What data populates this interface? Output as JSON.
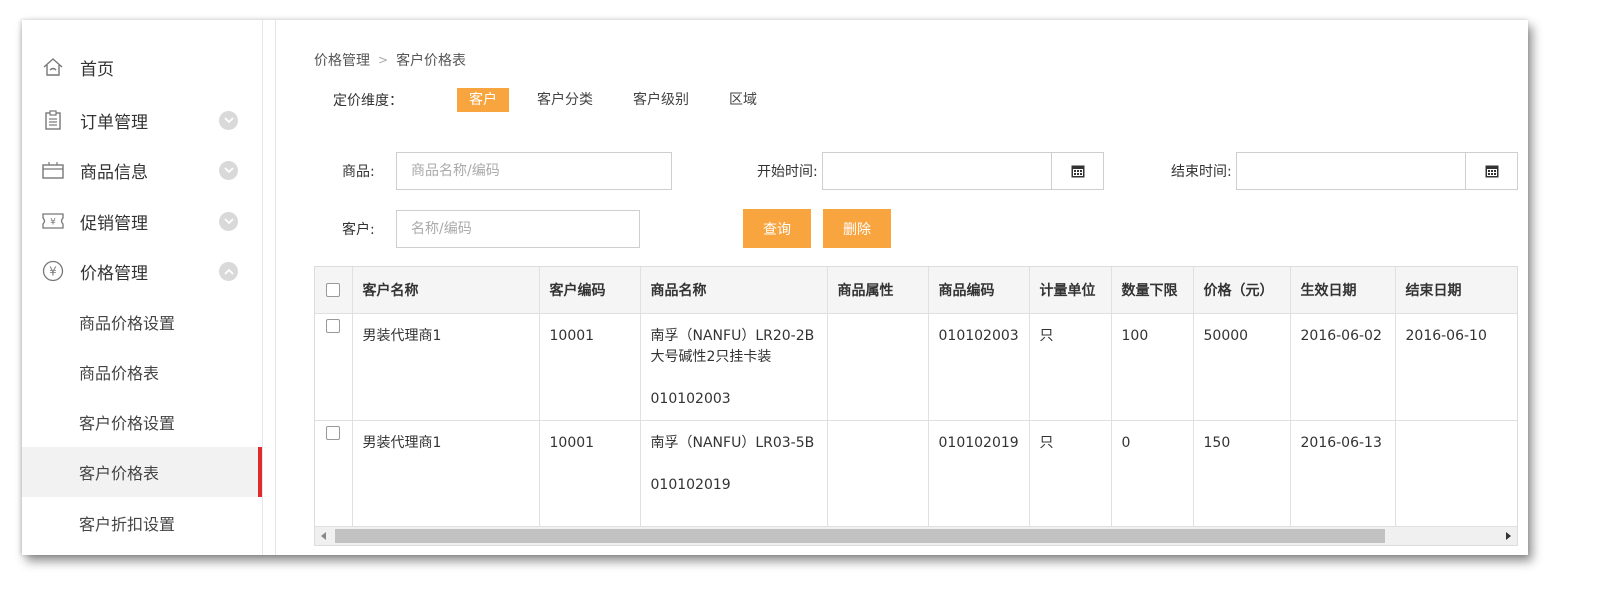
{
  "sidebar": {
    "items": [
      {
        "label": "首页",
        "icon": "home-icon"
      },
      {
        "label": "订单管理",
        "icon": "clipboard-icon"
      },
      {
        "label": "商品信息",
        "icon": "box-icon"
      },
      {
        "label": "促销管理",
        "icon": "ticket-icon"
      },
      {
        "label": "价格管理",
        "icon": "yen-icon"
      }
    ],
    "subitems": [
      {
        "label": "商品价格设置"
      },
      {
        "label": "商品价格表"
      },
      {
        "label": "客户价格设置"
      },
      {
        "label": "客户价格表"
      },
      {
        "label": "客户折扣设置"
      }
    ]
  },
  "breadcrumb": {
    "parent": "价格管理",
    "separator": ">",
    "current": "客户价格表"
  },
  "dimension": {
    "label": "定价维度：",
    "tabs": [
      "客户",
      "客户分类",
      "客户级别",
      "区域"
    ],
    "active": "客户"
  },
  "filters": {
    "product_label": "商品:",
    "product_placeholder": "商品名称/编码",
    "start_label": "开始时间:",
    "end_label": "结束时间:",
    "customer_label": "客户:",
    "customer_placeholder": "名称/编码",
    "query_button": "查询",
    "delete_button": "删除"
  },
  "table": {
    "headers": [
      "客户名称",
      "客户编码",
      "商品名称",
      "商品属性",
      "商品编码",
      "计量单位",
      "数量下限",
      "价格（元）",
      "生效日期",
      "结束日期"
    ],
    "rows": [
      {
        "customer_name": "男装代理商1",
        "customer_code": "10001",
        "product_name": "南孚（NANFU）LR20-2B 大号碱性2只挂卡装",
        "product_name_code": "010102003",
        "product_attr": "",
        "product_code": "010102003",
        "unit": "只",
        "min_qty": "100",
        "price": "50000",
        "start_date": "2016-06-02",
        "end_date": "2016-06-10"
      },
      {
        "customer_name": "男装代理商1",
        "customer_code": "10001",
        "product_name": "南孚（NANFU）LR03-5B",
        "product_name_code": "010102019",
        "product_attr": "",
        "product_code": "010102019",
        "unit": "只",
        "min_qty": "0",
        "price": "150",
        "start_date": "2016-06-13",
        "end_date": ""
      }
    ]
  },
  "colors": {
    "accent": "#f9a53f",
    "active_marker": "#e02b2b"
  }
}
